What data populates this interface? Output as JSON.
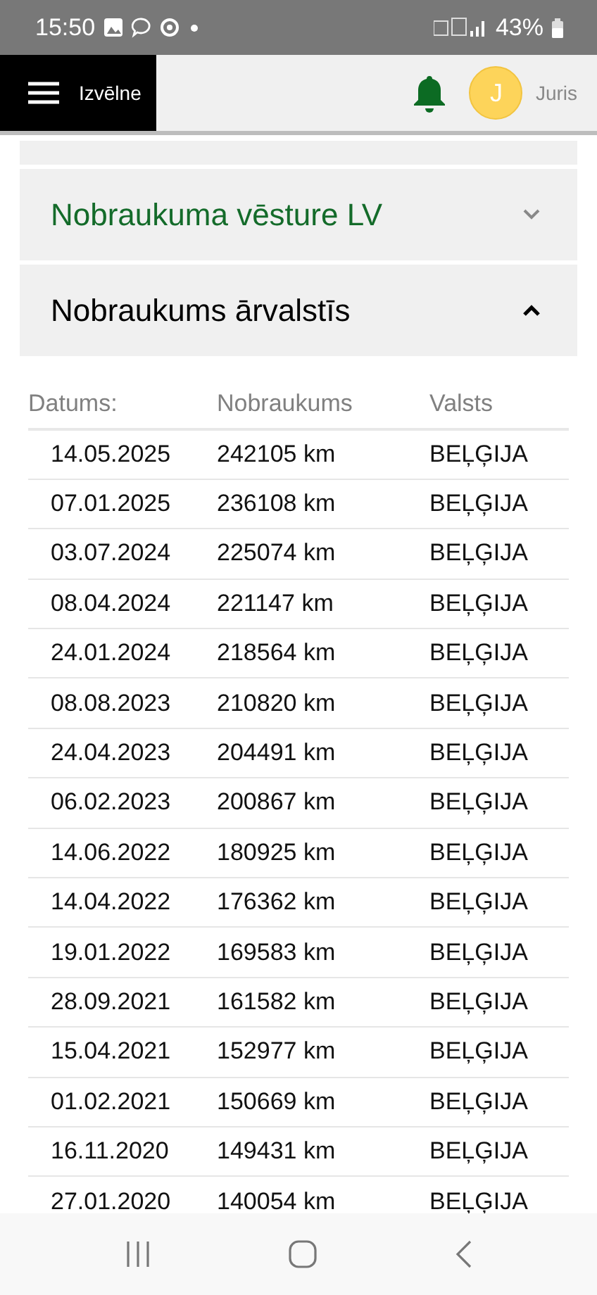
{
  "status_bar": {
    "time": "15:50",
    "battery": "43%"
  },
  "header": {
    "menu_label": "Izvēlne",
    "avatar_letter": "J",
    "user_name": "Juris"
  },
  "sections": [
    {
      "title": "Nobraukuma vēsture LV",
      "expanded": false
    },
    {
      "title": "Nobraukums ārvalstīs",
      "expanded": true
    }
  ],
  "table": {
    "columns": [
      "Datums:",
      "Nobraukums",
      "Valsts"
    ],
    "rows": [
      [
        "14.05.2025",
        "242105 km",
        "BEĻĢIJA"
      ],
      [
        "07.01.2025",
        "236108 km",
        "BEĻĢIJA"
      ],
      [
        "03.07.2024",
        "225074 km",
        "BEĻĢIJA"
      ],
      [
        "08.04.2024",
        "221147 km",
        "BEĻĢIJA"
      ],
      [
        "24.01.2024",
        "218564 km",
        "BEĻĢIJA"
      ],
      [
        "08.08.2023",
        "210820 km",
        "BEĻĢIJA"
      ],
      [
        "24.04.2023",
        "204491 km",
        "BEĻĢIJA"
      ],
      [
        "06.02.2023",
        "200867 km",
        "BEĻĢIJA"
      ],
      [
        "14.06.2022",
        "180925 km",
        "BEĻĢIJA"
      ],
      [
        "14.04.2022",
        "176362 km",
        "BEĻĢIJA"
      ],
      [
        "19.01.2022",
        "169583 km",
        "BEĻĢIJA"
      ],
      [
        "28.09.2021",
        "161582 km",
        "BEĻĢIJA"
      ],
      [
        "15.04.2021",
        "152977 km",
        "BEĻĢIJA"
      ],
      [
        "01.02.2021",
        "150669 km",
        "BEĻĢIJA"
      ],
      [
        "16.11.2020",
        "149431 km",
        "BEĻĢIJA"
      ],
      [
        "27.01.2020",
        "140054 km",
        "BEĻĢIJA"
      ]
    ]
  }
}
